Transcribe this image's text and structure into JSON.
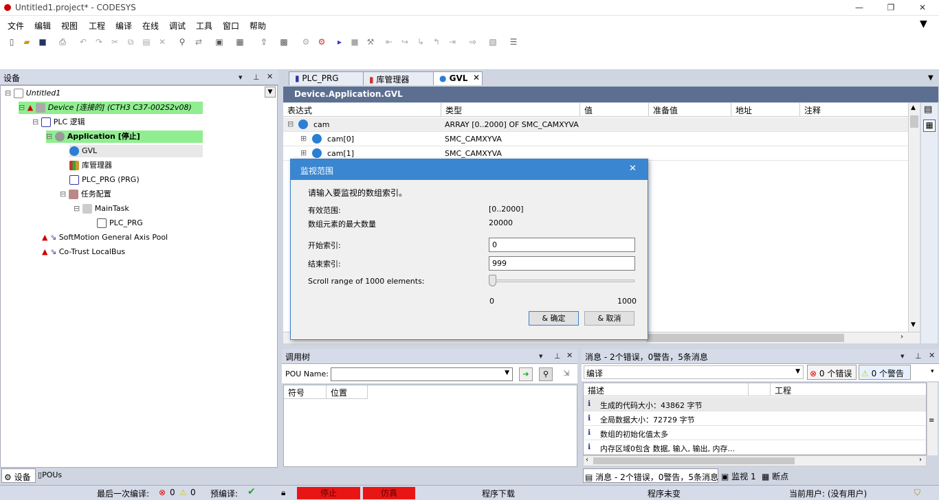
{
  "window": {
    "title": "Untitled1.project* - CODESYS",
    "min": "—",
    "max": "❐",
    "close": "✕"
  },
  "menu": [
    "文件",
    "编辑",
    "视图",
    "工程",
    "编译",
    "在线",
    "调试",
    "工具",
    "窗口",
    "帮助"
  ],
  "devices_panel": {
    "title": "设备",
    "tabs": [
      "设备",
      "POUs"
    ],
    "tree": [
      {
        "label": "Untitled1",
        "italic": true
      },
      {
        "label": "Device [连接的] (CTH3 C37-002S2v08)",
        "italic": true
      },
      {
        "label": "PLC 逻辑"
      },
      {
        "label": "Application [停止]",
        "bold": true
      },
      {
        "label": "GVL"
      },
      {
        "label": "库管理器"
      },
      {
        "label": "PLC_PRG (PRG)"
      },
      {
        "label": "任务配置"
      },
      {
        "label": "MainTask"
      },
      {
        "label": "PLC_PRG"
      },
      {
        "label": "SoftMotion General Axis Pool"
      },
      {
        "label": "Co-Trust LocalBus"
      }
    ]
  },
  "editor": {
    "tabs": [
      "PLC_PRG",
      "库管理器",
      "GVL"
    ],
    "path": "Device.Application.GVL",
    "columns": [
      "表达式",
      "类型",
      "值",
      "准备值",
      "地址",
      "注释"
    ],
    "rows": [
      {
        "expr": "cam",
        "type": "ARRAY [0..2000] OF SMC_CAMXYVA"
      },
      {
        "expr": "cam[0]",
        "type": "SMC_CAMXYVA"
      },
      {
        "expr": "cam[1]",
        "type": "SMC_CAMXYVA"
      }
    ]
  },
  "dialog": {
    "title": "监视范围",
    "prompt": "请输入要监视的数组索引。",
    "valid_label": "有效范围:",
    "valid_value": "[0..2000]",
    "max_label": "数组元素的最大数量",
    "max_value": "20000",
    "start_label": "开始索引:",
    "start_value": "0",
    "end_label": "结束索引:",
    "end_value": "999",
    "scroll_label": "Scroll range of 1000 elements:",
    "slider_min": "0",
    "slider_max": "1000",
    "slider_position": 0,
    "ok": "& 确定",
    "cancel": "& 取消"
  },
  "calltree": {
    "title": "调用树",
    "pou_label": "POU Name:",
    "columns": [
      "符号",
      "位置"
    ]
  },
  "messages": {
    "title": "消息 - 2个错误，0警告，5条消息",
    "filter": "编译",
    "errors": "0 个错误",
    "warnings": "0 个警告",
    "columns": [
      "描述",
      "工程"
    ],
    "rows": [
      "生成的代码大小：43862 字节",
      "全局数据大小：72729 字节",
      "数组的初始化值太多",
      "内存区域0包含 数据, 输入, 输出, 内存..."
    ],
    "bottom_tabs": [
      "消息 - 2个错误，0警告，5条消息",
      "监视 1",
      "断点"
    ]
  },
  "status": {
    "last_compile": "最后一次编译:",
    "err_count": "0",
    "warn_count": "0",
    "precompile": "预编译:",
    "stop": "停止",
    "sim": "仿真",
    "download": "程序下载",
    "unchanged": "程序未变",
    "user": "当前用户: (没有用户)"
  }
}
